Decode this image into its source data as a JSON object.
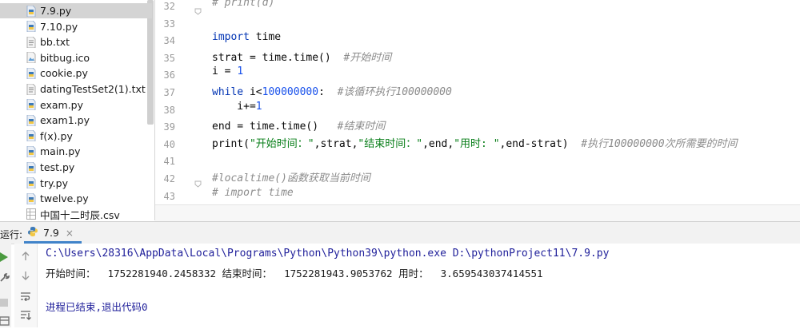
{
  "project_tree": {
    "items": [
      {
        "label": "7.9.py",
        "icon": "python-file-icon",
        "selected": true
      },
      {
        "label": "7.10.py",
        "icon": "python-file-icon"
      },
      {
        "label": "bb.txt",
        "icon": "text-file-icon"
      },
      {
        "label": "bitbug.ico",
        "icon": "image-file-icon"
      },
      {
        "label": "cookie.py",
        "icon": "python-file-icon"
      },
      {
        "label": "datingTestSet2(1).txt",
        "icon": "text-file-icon"
      },
      {
        "label": "exam.py",
        "icon": "python-file-icon"
      },
      {
        "label": "exam1.py",
        "icon": "python-file-icon"
      },
      {
        "label": "f(x).py",
        "icon": "python-file-icon"
      },
      {
        "label": "main.py",
        "icon": "python-file-icon"
      },
      {
        "label": "test.py",
        "icon": "python-file-icon"
      },
      {
        "label": "try.py",
        "icon": "python-file-icon"
      },
      {
        "label": "twelve.py",
        "icon": "python-file-icon"
      },
      {
        "label": "中国十二时辰.csv",
        "icon": "csv-file-icon"
      }
    ]
  },
  "editor": {
    "line_numbers": [
      "32",
      "33",
      "34",
      "35",
      "36",
      "37",
      "38",
      "39",
      "40",
      "41",
      "42",
      "43"
    ],
    "lines": [
      {
        "cm": "# print(d)"
      },
      {},
      {
        "kw": "import",
        "t": " time"
      },
      {
        "t": "strat = time.time()  ",
        "cm": "#开始时间"
      },
      {
        "t": "i = ",
        "num": "1"
      },
      {
        "kw": "while",
        "t": " i<",
        "num": "100000000",
        "t2": ":  ",
        "cm": "#该循环执行100000000"
      },
      {
        "t": "    i+=",
        "num": "1"
      },
      {
        "t": "end = time.time()   ",
        "cm": "#结束时间"
      },
      {
        "t": "print(",
        "s1": "\"开始时间：\"",
        "t2": ",strat,",
        "s2": "\"结束时间：\"",
        "t3": ",end,",
        "s3": "\"用时: \"",
        "t4": ",end-strat)  ",
        "cm": "#执行100000000次所需要的时间"
      },
      {},
      {
        "cm": "#localtime()函数获取当前时间"
      },
      {
        "cm": "# import time"
      }
    ]
  },
  "run_panel": {
    "label": "运行:",
    "tab_name": "7.9",
    "tab_close": "×",
    "command": "C:\\Users\\28316\\AppData\\Local\\Programs\\Python\\Python39\\python.exe D:\\pythonProject11\\7.9.py",
    "output": "开始时间：  1752281940.2458332 结束时间：  1752281943.9053762 用时：  3.659543037414551",
    "exit_message": "进程已结束,退出代码0"
  },
  "colors": {
    "keyword": "#0033b3",
    "number": "#1750eb",
    "string": "#067d17",
    "comment": "#8c8c8c",
    "console_path": "#1f1f9a",
    "tab_underline": "#4083c9",
    "run_green": "#4a9a3f"
  }
}
